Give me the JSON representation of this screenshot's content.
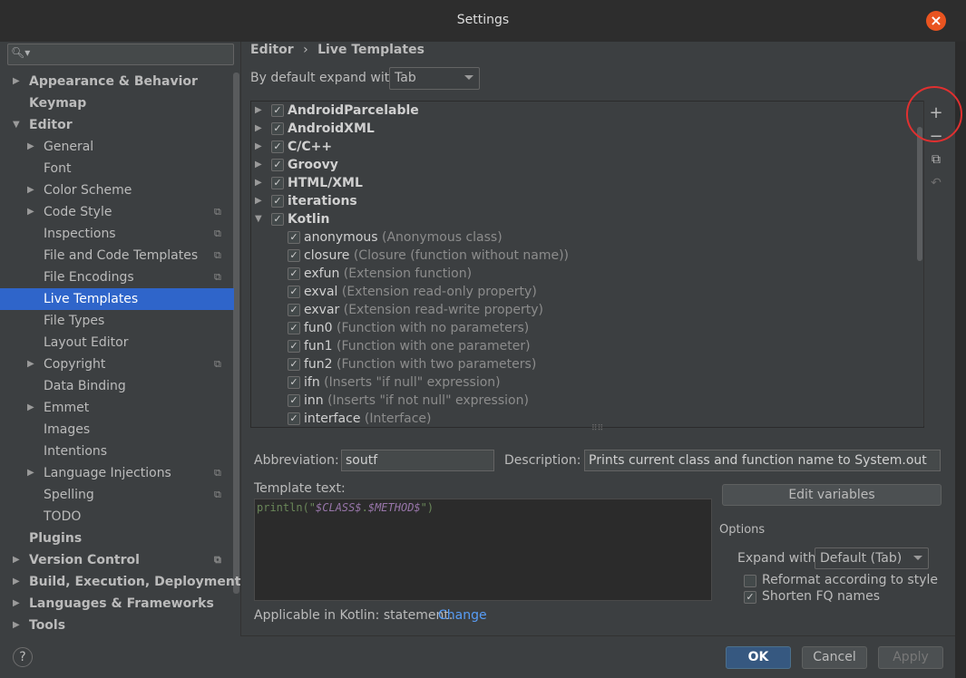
{
  "window": {
    "title": "Settings"
  },
  "search": {
    "placeholder": ""
  },
  "sidebar": {
    "items": [
      {
        "label": "Appearance & Behavior",
        "level": 0,
        "bold": true,
        "arrow": "right"
      },
      {
        "label": "Keymap",
        "level": 0,
        "bold": true,
        "arrow": ""
      },
      {
        "label": "Editor",
        "level": 0,
        "bold": true,
        "arrow": "down"
      },
      {
        "label": "General",
        "level": 1,
        "arrow": "right"
      },
      {
        "label": "Font",
        "level": 1,
        "arrow": ""
      },
      {
        "label": "Color Scheme",
        "level": 1,
        "arrow": "right"
      },
      {
        "label": "Code Style",
        "level": 1,
        "arrow": "right",
        "project": true
      },
      {
        "label": "Inspections",
        "level": 1,
        "arrow": "",
        "project": true
      },
      {
        "label": "File and Code Templates",
        "level": 1,
        "arrow": "",
        "project": true
      },
      {
        "label": "File Encodings",
        "level": 1,
        "arrow": "",
        "project": true
      },
      {
        "label": "Live Templates",
        "level": 1,
        "arrow": "",
        "selected": true
      },
      {
        "label": "File Types",
        "level": 1,
        "arrow": ""
      },
      {
        "label": "Layout Editor",
        "level": 1,
        "arrow": ""
      },
      {
        "label": "Copyright",
        "level": 1,
        "arrow": "right",
        "project": true
      },
      {
        "label": "Data Binding",
        "level": 1,
        "arrow": ""
      },
      {
        "label": "Emmet",
        "level": 1,
        "arrow": "right"
      },
      {
        "label": "Images",
        "level": 1,
        "arrow": ""
      },
      {
        "label": "Intentions",
        "level": 1,
        "arrow": ""
      },
      {
        "label": "Language Injections",
        "level": 1,
        "arrow": "right",
        "project": true
      },
      {
        "label": "Spelling",
        "level": 1,
        "arrow": "",
        "project": true
      },
      {
        "label": "TODO",
        "level": 1,
        "arrow": ""
      },
      {
        "label": "Plugins",
        "level": 0,
        "bold": true,
        "arrow": ""
      },
      {
        "label": "Version Control",
        "level": 0,
        "bold": true,
        "arrow": "right",
        "project": true
      },
      {
        "label": "Build, Execution, Deployment",
        "level": 0,
        "bold": true,
        "arrow": "right"
      },
      {
        "label": "Languages & Frameworks",
        "level": 0,
        "bold": true,
        "arrow": "right"
      },
      {
        "label": "Tools",
        "level": 0,
        "bold": true,
        "arrow": "right"
      }
    ]
  },
  "breadcrumb": {
    "parent": "Editor",
    "separator": "›",
    "current": "Live Templates"
  },
  "expand": {
    "label": "By default expand with",
    "value": "Tab"
  },
  "templates": {
    "groups": [
      {
        "name": "AndroidParcelable",
        "expanded": false,
        "checked": true
      },
      {
        "name": "AndroidXML",
        "expanded": false,
        "checked": true
      },
      {
        "name": "C/C++",
        "expanded": false,
        "checked": true
      },
      {
        "name": "Groovy",
        "expanded": false,
        "checked": true
      },
      {
        "name": "HTML/XML",
        "expanded": false,
        "checked": true
      },
      {
        "name": "iterations",
        "expanded": false,
        "checked": true
      },
      {
        "name": "Kotlin",
        "expanded": true,
        "checked": true
      }
    ],
    "items": [
      {
        "abbr": "anonymous",
        "desc": "(Anonymous class)",
        "checked": true
      },
      {
        "abbr": "closure",
        "desc": "(Closure (function without name))",
        "checked": true
      },
      {
        "abbr": "exfun",
        "desc": "(Extension function)",
        "checked": true
      },
      {
        "abbr": "exval",
        "desc": "(Extension read-only property)",
        "checked": true
      },
      {
        "abbr": "exvar",
        "desc": "(Extension read-write property)",
        "checked": true
      },
      {
        "abbr": "fun0",
        "desc": "(Function with no parameters)",
        "checked": true
      },
      {
        "abbr": "fun1",
        "desc": "(Function with one parameter)",
        "checked": true
      },
      {
        "abbr": "fun2",
        "desc": "(Function with two parameters)",
        "checked": true
      },
      {
        "abbr": "ifn",
        "desc": "(Inserts \"if null\" expression)",
        "checked": true
      },
      {
        "abbr": "inn",
        "desc": "(Inserts \"if not null\" expression)",
        "checked": true
      },
      {
        "abbr": "interface",
        "desc": "(Interface)",
        "checked": true
      }
    ]
  },
  "toolbar": {
    "add": "+",
    "remove": "−",
    "copy": "⧉",
    "restore": "↶"
  },
  "details": {
    "abbreviation_label": "Abbreviation:",
    "abbreviation_value": "soutf",
    "description_label": "Description:",
    "description_value": "Prints current class and function name to System.out",
    "template_label": "Template text:",
    "template_prefix": "println(\"",
    "template_var1": "$CLASS$",
    "template_dot": ".",
    "template_var2": "$METHOD$",
    "template_suffix": "\")",
    "edit_variables": "Edit variables",
    "applicable_text": "Applicable in Kotlin: statement.",
    "applicable_link": "Change"
  },
  "options": {
    "title": "Options",
    "expand_label": "Expand with",
    "expand_value": "Default (Tab)",
    "reformat_label": "Reformat according to style",
    "reformat_checked": false,
    "shorten_label": "Shorten FQ names",
    "shorten_checked": true
  },
  "footer": {
    "help": "?",
    "ok": "OK",
    "cancel": "Cancel",
    "apply": "Apply"
  }
}
